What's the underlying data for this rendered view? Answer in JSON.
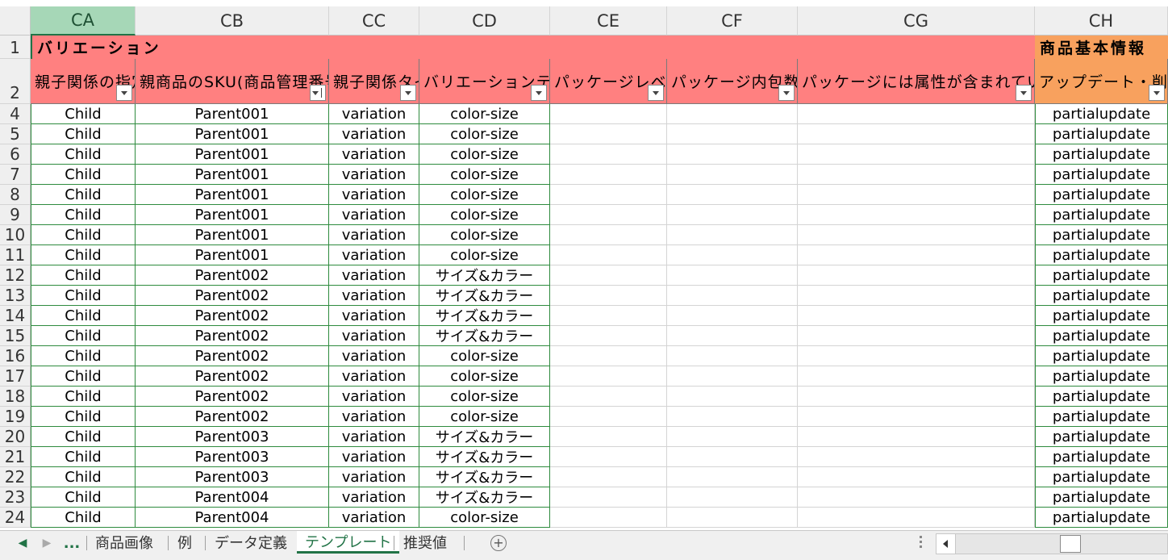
{
  "columns": [
    {
      "id": "CA",
      "selected": true
    },
    {
      "id": "CB"
    },
    {
      "id": "CC"
    },
    {
      "id": "CD"
    },
    {
      "id": "CE"
    },
    {
      "id": "CF"
    },
    {
      "id": "CG"
    },
    {
      "id": "CH"
    }
  ],
  "band_row": {
    "row": "1",
    "variation_label": "バリエーション",
    "basic_info_label": "商品基本情報",
    "variation_color": "#ff8080",
    "basic_info_color": "#f8a15e"
  },
  "header_row": {
    "row": "2",
    "cells": [
      "親子関係の指定",
      "親商品のSKU(商品管理番号)",
      "親子関係タイプ",
      "バリエーションテーマ",
      "パッケージレベル",
      "パッケージ内包数",
      "パッケージには属性が含まれています",
      "アップデート・削除"
    ]
  },
  "rows": [
    {
      "n": "4",
      "ca": "Child",
      "cb": "Parent001",
      "cc": "variation",
      "cd": "color-size",
      "ch": "partialupdate"
    },
    {
      "n": "5",
      "ca": "Child",
      "cb": "Parent001",
      "cc": "variation",
      "cd": "color-size",
      "ch": "partialupdate"
    },
    {
      "n": "6",
      "ca": "Child",
      "cb": "Parent001",
      "cc": "variation",
      "cd": "color-size",
      "ch": "partialupdate"
    },
    {
      "n": "7",
      "ca": "Child",
      "cb": "Parent001",
      "cc": "variation",
      "cd": "color-size",
      "ch": "partialupdate"
    },
    {
      "n": "8",
      "ca": "Child",
      "cb": "Parent001",
      "cc": "variation",
      "cd": "color-size",
      "ch": "partialupdate"
    },
    {
      "n": "9",
      "ca": "Child",
      "cb": "Parent001",
      "cc": "variation",
      "cd": "color-size",
      "ch": "partialupdate"
    },
    {
      "n": "10",
      "ca": "Child",
      "cb": "Parent001",
      "cc": "variation",
      "cd": "color-size",
      "ch": "partialupdate"
    },
    {
      "n": "11",
      "ca": "Child",
      "cb": "Parent001",
      "cc": "variation",
      "cd": "color-size",
      "ch": "partialupdate"
    },
    {
      "n": "12",
      "ca": "Child",
      "cb": "Parent002",
      "cc": "variation",
      "cd": "サイズ&カラー",
      "ch": "partialupdate"
    },
    {
      "n": "13",
      "ca": "Child",
      "cb": "Parent002",
      "cc": "variation",
      "cd": "サイズ&カラー",
      "ch": "partialupdate"
    },
    {
      "n": "14",
      "ca": "Child",
      "cb": "Parent002",
      "cc": "variation",
      "cd": "サイズ&カラー",
      "ch": "partialupdate"
    },
    {
      "n": "15",
      "ca": "Child",
      "cb": "Parent002",
      "cc": "variation",
      "cd": "サイズ&カラー",
      "ch": "partialupdate"
    },
    {
      "n": "16",
      "ca": "Child",
      "cb": "Parent002",
      "cc": "variation",
      "cd": "color-size",
      "ch": "partialupdate"
    },
    {
      "n": "17",
      "ca": "Child",
      "cb": "Parent002",
      "cc": "variation",
      "cd": "color-size",
      "ch": "partialupdate"
    },
    {
      "n": "18",
      "ca": "Child",
      "cb": "Parent002",
      "cc": "variation",
      "cd": "color-size",
      "ch": "partialupdate"
    },
    {
      "n": "19",
      "ca": "Child",
      "cb": "Parent002",
      "cc": "variation",
      "cd": "color-size",
      "ch": "partialupdate"
    },
    {
      "n": "20",
      "ca": "Child",
      "cb": "Parent003",
      "cc": "variation",
      "cd": "サイズ&カラー",
      "ch": "partialupdate"
    },
    {
      "n": "21",
      "ca": "Child",
      "cb": "Parent003",
      "cc": "variation",
      "cd": "サイズ&カラー",
      "ch": "partialupdate"
    },
    {
      "n": "22",
      "ca": "Child",
      "cb": "Parent003",
      "cc": "variation",
      "cd": "サイズ&カラー",
      "ch": "partialupdate"
    },
    {
      "n": "23",
      "ca": "Child",
      "cb": "Parent004",
      "cc": "variation",
      "cd": "サイズ&カラー",
      "ch": "partialupdate"
    },
    {
      "n": "24",
      "ca": "Child",
      "cb": "Parent004",
      "cc": "variation",
      "cd": "color-size",
      "ch": "partialupdate"
    }
  ],
  "tabs": {
    "more_label": "...",
    "items": [
      {
        "label": "商品画像",
        "active": false
      },
      {
        "label": "例",
        "active": false
      },
      {
        "label": "データ定義",
        "active": false
      },
      {
        "label": "テンプレート",
        "active": true
      },
      {
        "label": "推奨値",
        "active": false
      }
    ],
    "add_label": "+"
  },
  "accent_color": "#217346"
}
